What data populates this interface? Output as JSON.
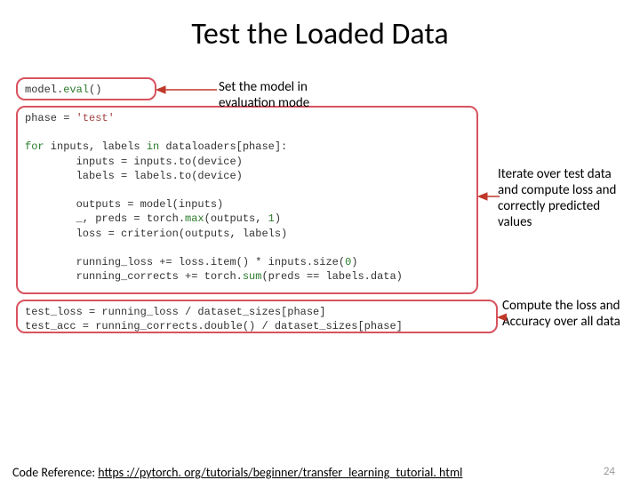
{
  "title": "Test the Loaded Data",
  "code": {
    "box1": "model.",
    "box1_fn": "eval",
    "box1_tail": "()",
    "box2_l1a": "phase = ",
    "box2_l1b": "'test'",
    "box2_l2a": "for",
    "box2_l2b": " inputs, labels ",
    "box2_l2c": "in",
    "box2_l2d": " dataloaders[phase]:",
    "box2_l3": "        inputs = inputs.to(device)",
    "box2_l4": "        labels = labels.to(device)",
    "box2_l5": "        outputs = model(inputs)",
    "box2_l6a": "        _, preds = torch.",
    "box2_l6b": "max",
    "box2_l6c": "(outputs, ",
    "box2_l6d": "1",
    "box2_l6e": ")",
    "box2_l7": "        loss = criterion(outputs, labels)",
    "box2_l8a": "        running_loss += loss.item() * inputs.size(",
    "box2_l8b": "0",
    "box2_l8c": ")",
    "box2_l9a": "        running_corrects += torch.",
    "box2_l9b": "sum",
    "box2_l9c": "(preds == labels.data)",
    "box3_l1": "test_loss = running_loss / dataset_sizes[phase]",
    "box3_l2": "test_acc = running_corrects.double() / dataset_sizes[phase]"
  },
  "annotations": {
    "a1": "Set the model in evaluation mode",
    "a2": "Iterate over test data and compute loss and correctly predicted values",
    "a3": "Compute the loss and Accuracy over all data"
  },
  "footer_label": "Code Reference: ",
  "footer_link": "https ://pytorch. org/tutorials/beginner/transfer_learning_tutorial. html",
  "page_number": "24"
}
